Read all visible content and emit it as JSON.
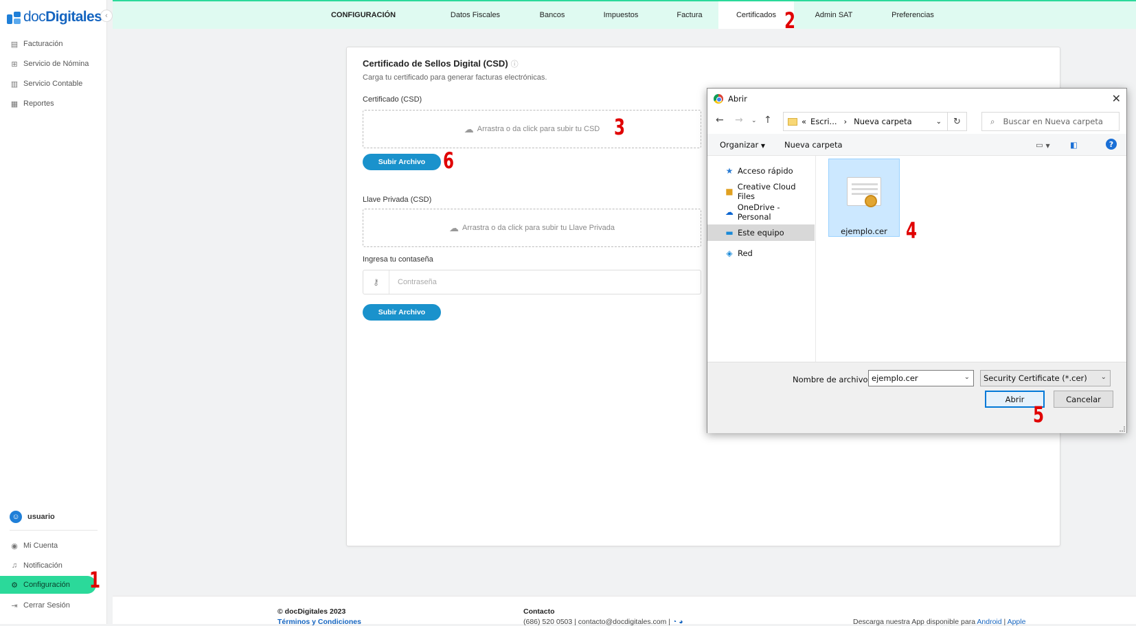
{
  "app": {
    "logo_doc": "doc",
    "logo_digitales": "Digitales"
  },
  "sidebar": {
    "items": [
      {
        "label": "Facturación",
        "icon": "document-icon"
      },
      {
        "label": "Servicio de Nómina",
        "icon": "payroll-icon"
      },
      {
        "label": "Servicio Contable",
        "icon": "ledger-icon"
      },
      {
        "label": "Reportes",
        "icon": "report-icon"
      }
    ],
    "user": "usuario",
    "bottom_items": [
      {
        "label": "Mi Cuenta",
        "icon": "account-icon"
      },
      {
        "label": "Notificación",
        "icon": "bell-icon"
      },
      {
        "label": "Configuración",
        "icon": "gear-icon"
      },
      {
        "label": "Cerrar Sesión",
        "icon": "logout-icon"
      }
    ]
  },
  "topnav": {
    "title": "CONFIGURACIÓN",
    "tabs": [
      "Datos Fiscales",
      "Bancos",
      "Impuestos",
      "Factura",
      "Certificados",
      "Admin SAT",
      "Preferencias"
    ],
    "active_tab": "Certificados"
  },
  "card": {
    "title": "Certificado de Sellos Digital (CSD)",
    "info_glyph": "ⓘ",
    "subtitle": "Carga tu certificado para generar facturas electrónicas.",
    "cert_label": "Certificado (CSD)",
    "cert_drop": "Arrastra o da click para subir tu CSD",
    "upload_button": "Subir Archivo",
    "key_label": "Llave Privada (CSD)",
    "key_drop": "Arrastra o da click para subir tu Llave Privada",
    "password_label": "Ingresa tu contaseña",
    "password_placeholder": "Contraseña",
    "upload_button_2": "Subir Archivo"
  },
  "footer": {
    "copyright": "© docDigitales 2023",
    "terms": "Términos y Condiciones",
    "contact_title": "Contacto",
    "contact_line": "(686) 520 0503 | contacto@docdigitales.com |",
    "app_text": "Descarga nuestra App disponible para",
    "android": "Android",
    "separator": "|",
    "apple": "Apple"
  },
  "dialog": {
    "title": "Abrir",
    "breadcrumb_prefix": "«",
    "breadcrumb_parent": "Escri...",
    "breadcrumb_sep": "›",
    "breadcrumb_current": "Nueva carpeta",
    "search_placeholder": "Buscar en Nueva carpeta",
    "organize": "Organizar",
    "new_folder": "Nueva carpeta",
    "nav_items": [
      {
        "label": "Acceso rápido",
        "icon": "star-icon"
      },
      {
        "label": "Creative Cloud Files",
        "icon": "creative-cloud-icon"
      },
      {
        "label": "OneDrive - Personal",
        "icon": "onedrive-icon"
      },
      {
        "label": "Este equipo",
        "icon": "computer-icon"
      },
      {
        "label": "Red",
        "icon": "network-icon"
      }
    ],
    "selected_nav": "Este equipo",
    "file_name": "ejemplo.cer",
    "filename_label": "Nombre de archivo:",
    "filename_value": "ejemplo.cer",
    "filetype": "Security Certificate (*.cer)",
    "open_button": "Abrir",
    "cancel_button": "Cancelar"
  },
  "markers": [
    "1",
    "2",
    "3",
    "4",
    "5",
    "6"
  ],
  "colors": {
    "accent_green": "#2bd99a",
    "primary_blue": "#1a92cc",
    "marker_red": "#e00000"
  }
}
